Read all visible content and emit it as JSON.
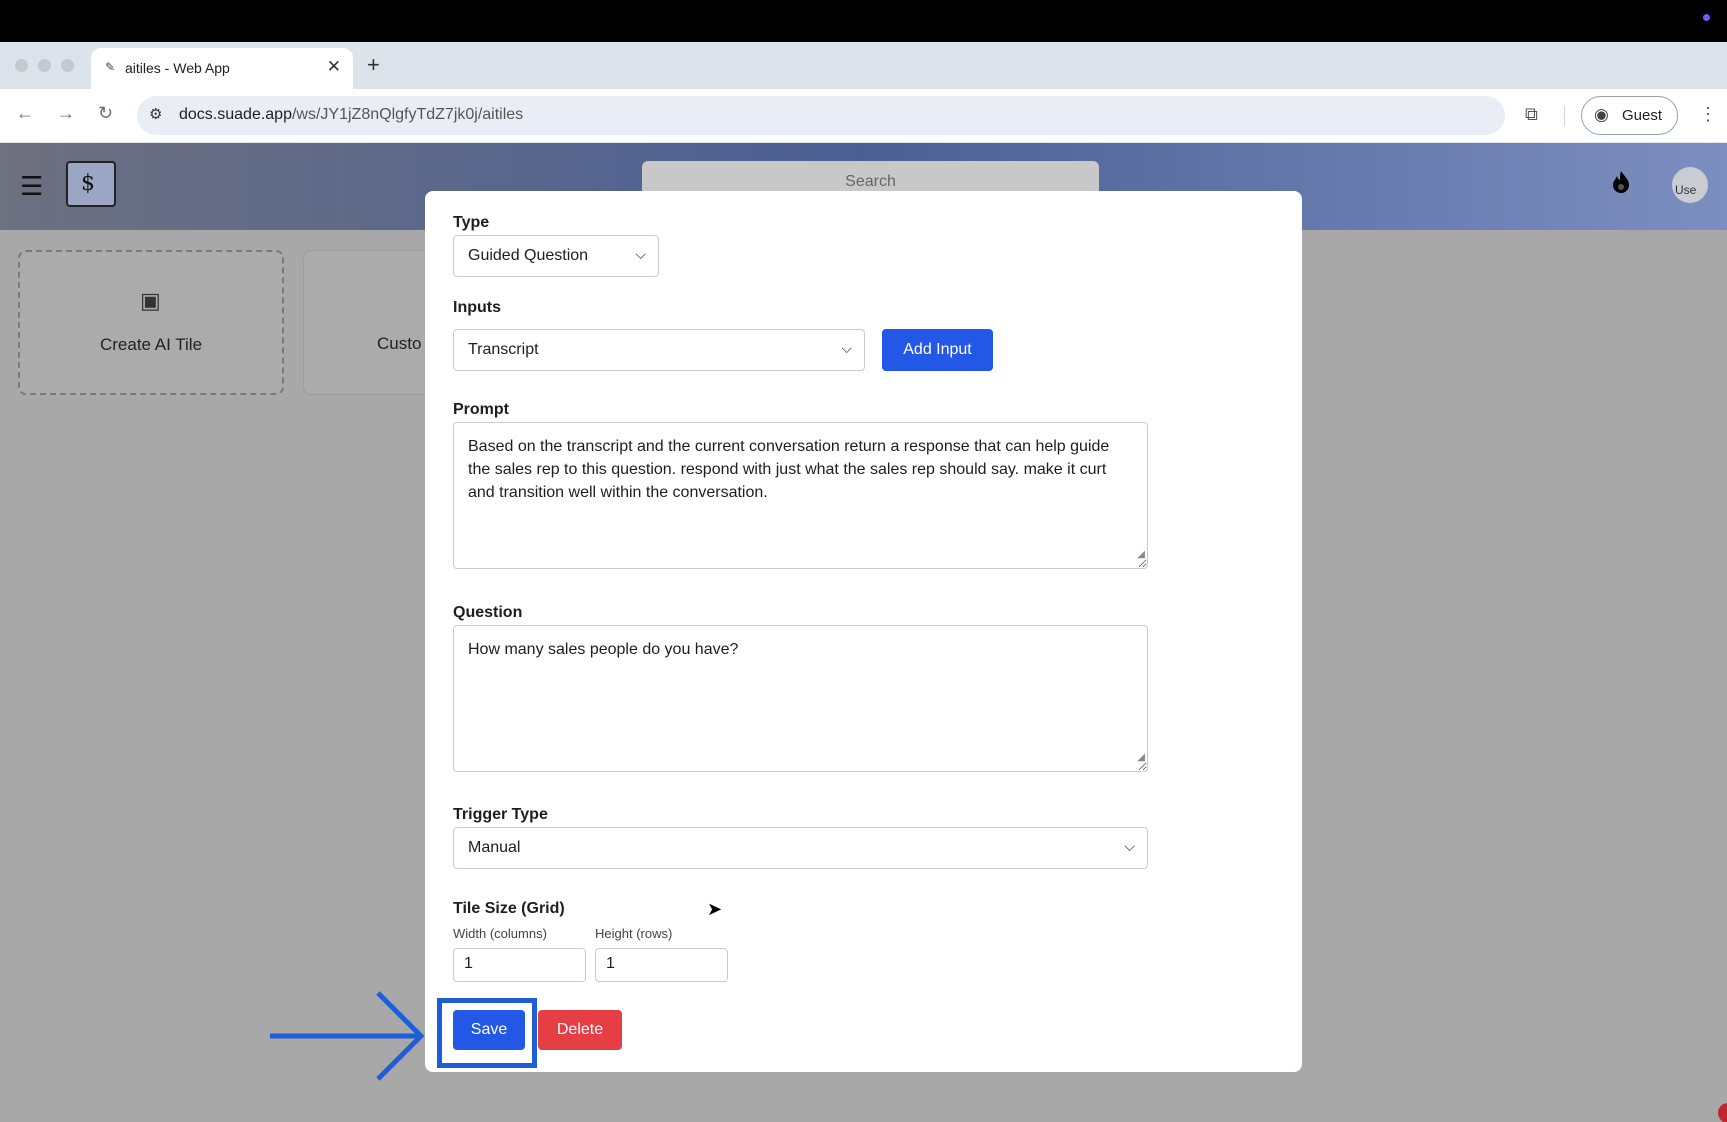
{
  "browser": {
    "tab_title": "aitiles - Web App",
    "tab_favicon": "✎",
    "url_domain": "docs.suade.app",
    "url_path": "/ws/JY1jZ8nQlgfyTdZ7jk0j/aitiles",
    "guest_label": "Guest"
  },
  "app": {
    "search_placeholder": "Search",
    "avatar_text": "Use",
    "cards": [
      {
        "label": "Create AI Tile"
      },
      {
        "label": "Custo"
      }
    ]
  },
  "modal": {
    "type_label": "Type",
    "type_value": "Guided Question",
    "inputs_label": "Inputs",
    "inputs_value": "Transcript",
    "add_input_label": "Add Input",
    "prompt_label": "Prompt",
    "prompt_value": "Based on the transcript and the current conversation return a response that can help guide the sales rep to this question. respond with just what the sales rep should say. make it curt and transition well within the conversation.",
    "question_label": "Question",
    "question_value": "How many sales people do you have?",
    "trigger_type_label": "Trigger Type",
    "trigger_type_value": "Manual",
    "tile_size_label": "Tile Size (Grid)",
    "width_label": "Width (columns)",
    "width_value": "1",
    "height_label": "Height (rows)",
    "height_value": "1",
    "save_label": "Save",
    "delete_label": "Delete"
  },
  "icons": {
    "back": "back-arrow-icon",
    "forward": "forward-arrow-icon",
    "reload": "reload-icon",
    "menu": "hamburger-icon",
    "flame": "flame-icon",
    "chip": "chip-icon",
    "chevron": "chevron-down-icon"
  },
  "colors": {
    "primary": "#2357e6",
    "danger": "#e63e45",
    "annotation": "#1d5ed8"
  }
}
